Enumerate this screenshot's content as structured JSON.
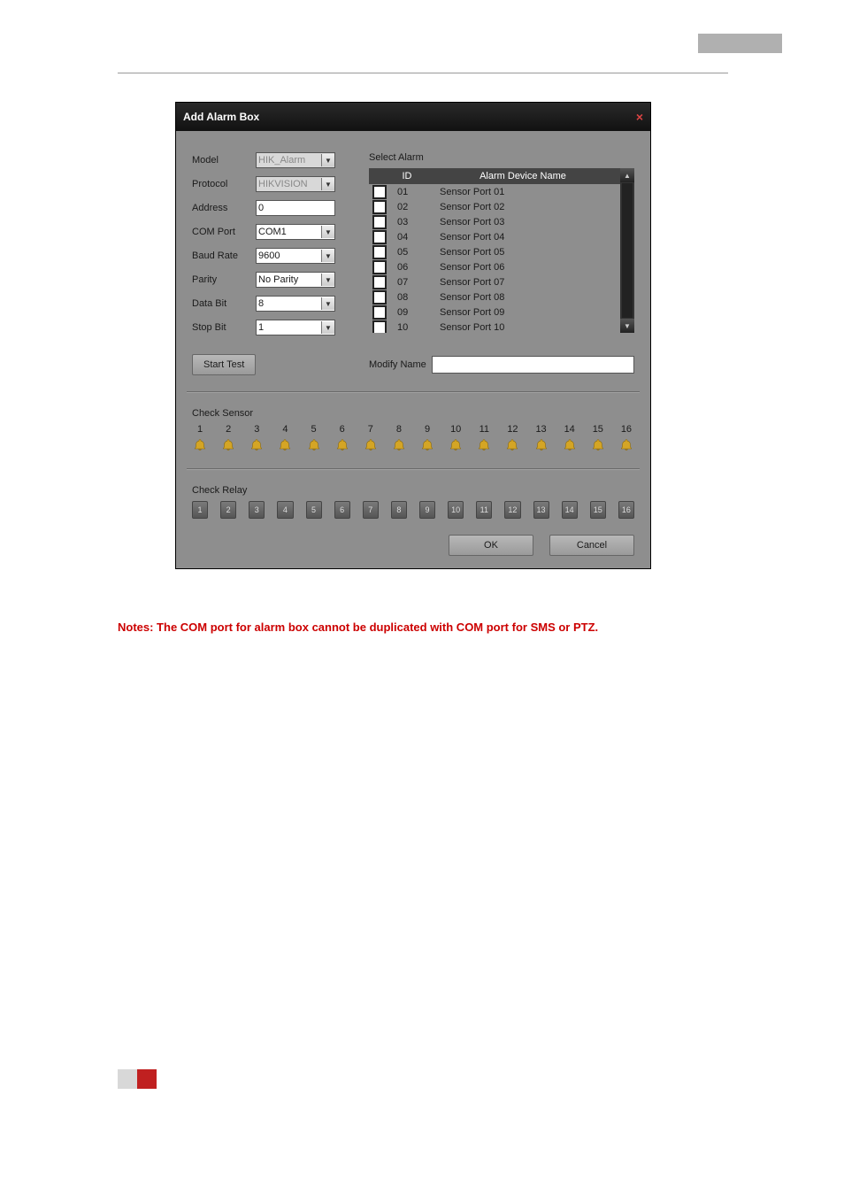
{
  "dialog": {
    "title": "Add Alarm Box",
    "labels": {
      "model": "Model",
      "protocol": "Protocol",
      "address": "Address",
      "com_port": "COM Port",
      "baud_rate": "Baud Rate",
      "parity": "Parity",
      "data_bit": "Data Bit",
      "stop_bit": "Stop Bit",
      "select_alarm": "Select Alarm",
      "start_test": "Start Test",
      "modify_name": "Modify Name",
      "check_sensor": "Check Sensor",
      "check_relay": "Check Relay",
      "ok": "OK",
      "cancel": "Cancel"
    },
    "values": {
      "model": "HIK_Alarm",
      "protocol": "HIKVISION",
      "address": "0",
      "com_port": "COM1",
      "baud_rate": "9600",
      "parity": "No Parity",
      "data_bit": "8",
      "stop_bit": "1",
      "modify_name": ""
    },
    "table": {
      "head_id": "ID",
      "head_name": "Alarm Device Name",
      "rows": [
        {
          "id": "01",
          "name": "Sensor Port 01"
        },
        {
          "id": "02",
          "name": "Sensor Port 02"
        },
        {
          "id": "03",
          "name": "Sensor Port 03"
        },
        {
          "id": "04",
          "name": "Sensor Port 04"
        },
        {
          "id": "05",
          "name": "Sensor Port 05"
        },
        {
          "id": "06",
          "name": "Sensor Port 06"
        },
        {
          "id": "07",
          "name": "Sensor Port 07"
        },
        {
          "id": "08",
          "name": "Sensor Port 08"
        },
        {
          "id": "09",
          "name": "Sensor Port 09"
        },
        {
          "id": "10",
          "name": "Sensor Port 10"
        }
      ]
    },
    "sensors": [
      "1",
      "2",
      "3",
      "4",
      "5",
      "6",
      "7",
      "8",
      "9",
      "10",
      "11",
      "12",
      "13",
      "14",
      "15",
      "16"
    ],
    "relays": [
      "1",
      "2",
      "3",
      "4",
      "5",
      "6",
      "7",
      "8",
      "9",
      "10",
      "11",
      "12",
      "13",
      "14",
      "15",
      "16"
    ]
  },
  "notes": "Notes: The COM port for alarm box cannot be duplicated with COM port for SMS or PTZ."
}
